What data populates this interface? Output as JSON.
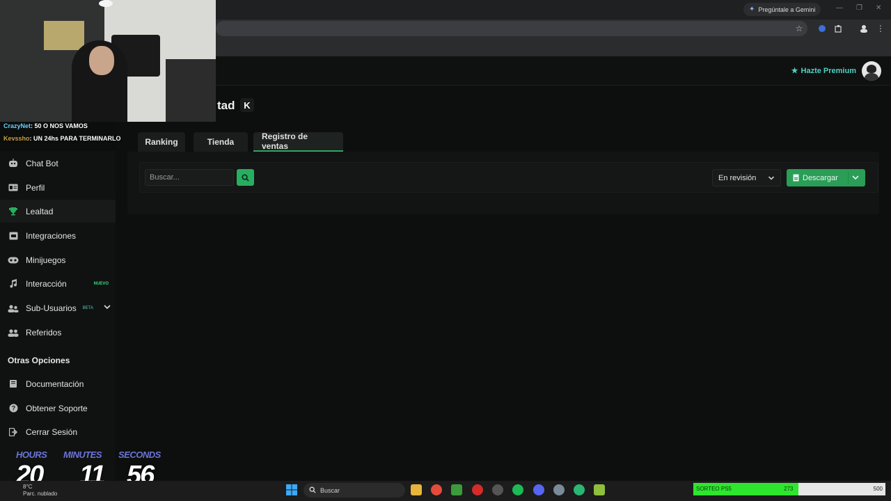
{
  "browser": {
    "gemini_label": "Pregúntale a Gemini"
  },
  "header": {
    "premium_label": "Hazte Premium"
  },
  "page": {
    "title_partial": "tad",
    "badge_letter": "K"
  },
  "tabs": [
    {
      "label": "Ranking"
    },
    {
      "label": "Tienda"
    },
    {
      "label": "Registro de ventas",
      "active": true
    }
  ],
  "toolbar": {
    "search_placeholder": "Buscar...",
    "status_selected": "En revisión",
    "download_label": "Descargar"
  },
  "sidebar": {
    "items": [
      {
        "label": "Chat Bot",
        "icon": "robot-icon"
      },
      {
        "label": "Perfil",
        "icon": "id-card-icon"
      },
      {
        "label": "Lealtad",
        "icon": "trophy-icon",
        "active": true
      },
      {
        "label": "Integraciones",
        "icon": "plug-icon"
      },
      {
        "label": "Minijuegos",
        "icon": "gamepad-icon"
      },
      {
        "label": "Interacción",
        "icon": "music-icon",
        "badge": "NUEVO"
      },
      {
        "label": "Sub-Usuarios",
        "icon": "users-icon",
        "badge": "BETA"
      },
      {
        "label": "Referidos",
        "icon": "user-group-icon"
      }
    ],
    "other_title": "Otras Opciones",
    "other_items": [
      {
        "label": "Documentación",
        "icon": "book-icon"
      },
      {
        "label": "Obtener Soporte",
        "icon": "question-icon"
      },
      {
        "label": "Cerrar Sesión",
        "icon": "logout-icon"
      }
    ]
  },
  "stream": {
    "chat": [
      {
        "user": "CrazyNet",
        "message": ": 50 O NOS VAMOS"
      },
      {
        "user": "Kevssho",
        "message": ": UN 24hs PARA TERMINARLO"
      }
    ],
    "timer": {
      "hours_label": "HOURS",
      "hours": "20",
      "minutes_label": "MINUTES",
      "minutes": "11",
      "seconds_label": "SECONDS",
      "seconds": "56"
    }
  },
  "taskbar": {
    "weather": "Parc. nublado",
    "temperature": "8°C",
    "search_label": "Buscar",
    "sorteo_label": "SORTEO PS5",
    "sorteo_value": "273",
    "sorteo_max": "500",
    "sorteo_progress": 0.546
  },
  "colors": {
    "accent": "#27ae60",
    "premium": "#4fd1c5"
  }
}
